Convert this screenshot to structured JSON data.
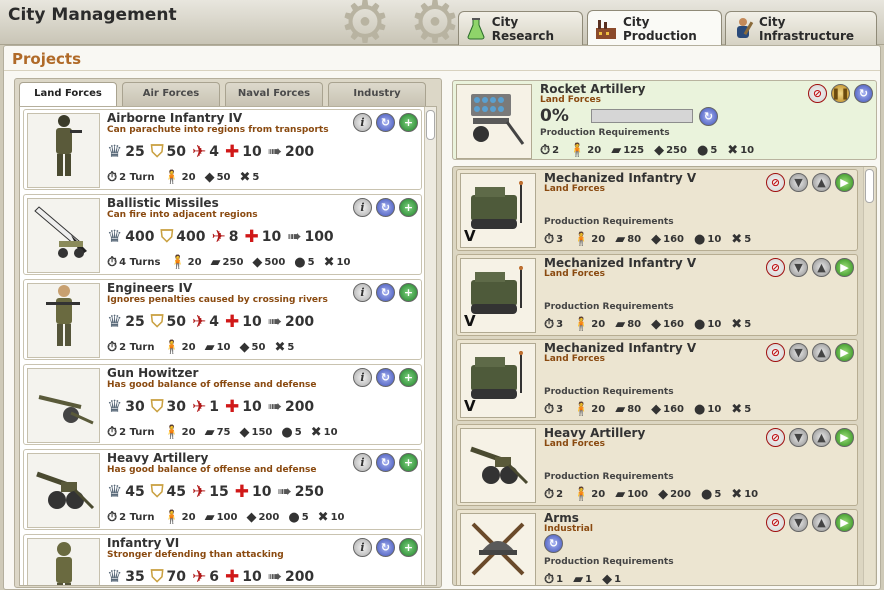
{
  "window": {
    "title": "City Management"
  },
  "main_tabs": [
    {
      "label": "City Research",
      "icon": "flask-icon",
      "active": false
    },
    {
      "label": "City Production",
      "icon": "factory-icon",
      "active": true
    },
    {
      "label": "City Infrastructure",
      "icon": "worker-icon",
      "active": false
    }
  ],
  "projects_heading": "Projects",
  "sub_tabs": [
    {
      "label": "Land Forces",
      "active": true
    },
    {
      "label": "Air Forces",
      "active": false
    },
    {
      "label": "Naval Forces",
      "active": false
    },
    {
      "label": "Industry",
      "active": false
    }
  ],
  "units": [
    {
      "name": "Airborne Infantry IV",
      "desc": "Can parachute into regions from transports",
      "icon": "paratrooper-icon",
      "attack": "25",
      "defense": "50",
      "anti_air": "4",
      "health": "10",
      "speed": "200",
      "turns": "2 Turn",
      "manpower": "20",
      "steel": "",
      "iron": "50",
      "oil": "",
      "rare": "5"
    },
    {
      "name": "Ballistic Missiles",
      "desc": "Can fire into adjacent regions",
      "icon": "missile-icon",
      "attack": "400",
      "defense": "400",
      "anti_air": "8",
      "health": "10",
      "speed": "100",
      "turns": "4 Turns",
      "manpower": "20",
      "steel": "250",
      "iron": "500",
      "oil": "5",
      "rare": "10"
    },
    {
      "name": "Engineers IV",
      "desc": "Ignores penalties caused by crossing rivers",
      "icon": "engineer-icon",
      "attack": "25",
      "defense": "50",
      "anti_air": "4",
      "health": "10",
      "speed": "200",
      "turns": "2 Turn",
      "manpower": "20",
      "steel": "10",
      "iron": "50",
      "oil": "",
      "rare": "5"
    },
    {
      "name": "Gun Howitzer",
      "desc": "Has good balance of offense and defense",
      "icon": "howitzer-icon",
      "attack": "30",
      "defense": "30",
      "anti_air": "1",
      "health": "10",
      "speed": "200",
      "turns": "2 Turn",
      "manpower": "20",
      "steel": "75",
      "iron": "150",
      "oil": "5",
      "rare": "10"
    },
    {
      "name": "Heavy Artillery",
      "desc": "Has good balance of offense and defense",
      "icon": "artillery-icon",
      "attack": "45",
      "defense": "45",
      "anti_air": "15",
      "health": "10",
      "speed": "250",
      "turns": "2 Turn",
      "manpower": "20",
      "steel": "100",
      "iron": "200",
      "oil": "5",
      "rare": "10"
    },
    {
      "name": "Infantry VI",
      "desc": "Stronger defending than attacking",
      "icon": "infantry-icon",
      "attack": "35",
      "defense": "70",
      "anti_air": "6",
      "health": "10",
      "speed": "200",
      "turns": "",
      "manpower": "",
      "steel": "",
      "iron": "",
      "oil": "",
      "rare": ""
    }
  ],
  "current_production": {
    "name": "Rocket Artillery",
    "category": "Land Forces",
    "icon": "rocket-artillery-icon",
    "percent_label": "0%",
    "progress": 0,
    "req_label": "Production Requirements",
    "turns": "2",
    "manpower": "20",
    "steel": "125",
    "iron": "250",
    "oil": "5",
    "rare": "10"
  },
  "queue": [
    {
      "name": "Mechanized Infantry V",
      "category": "Land Forces",
      "icon": "halftrack-icon",
      "level": "V",
      "cycle": false,
      "req_label": "Production Requirements",
      "turns": "3",
      "manpower": "20",
      "steel": "80",
      "iron": "160",
      "oil": "10",
      "rare": "5"
    },
    {
      "name": "Mechanized Infantry V",
      "category": "Land Forces",
      "icon": "halftrack-icon",
      "level": "V",
      "cycle": false,
      "req_label": "Production Requirements",
      "turns": "3",
      "manpower": "20",
      "steel": "80",
      "iron": "160",
      "oil": "10",
      "rare": "5"
    },
    {
      "name": "Mechanized Infantry V",
      "category": "Land Forces",
      "icon": "halftrack-icon",
      "level": "V",
      "cycle": false,
      "req_label": "Production Requirements",
      "turns": "3",
      "manpower": "20",
      "steel": "80",
      "iron": "160",
      "oil": "10",
      "rare": "5"
    },
    {
      "name": "Heavy Artillery",
      "category": "Land Forces",
      "icon": "artillery-icon",
      "level": "",
      "cycle": false,
      "req_label": "Production Requirements",
      "turns": "2",
      "manpower": "20",
      "steel": "100",
      "iron": "200",
      "oil": "5",
      "rare": "10"
    },
    {
      "name": "Arms",
      "category": "Industrial",
      "icon": "arms-icon",
      "level": "",
      "cycle": true,
      "req_label": "Production Requirements",
      "turns": "1",
      "manpower": "",
      "steel": "1",
      "iron": "1",
      "oil": "",
      "rare": ""
    }
  ],
  "colors": {
    "accent": "#b06a28",
    "desc": "#8a4a10",
    "current_bg": "#eaf3dc",
    "queue_bg": "#ece5d1"
  }
}
